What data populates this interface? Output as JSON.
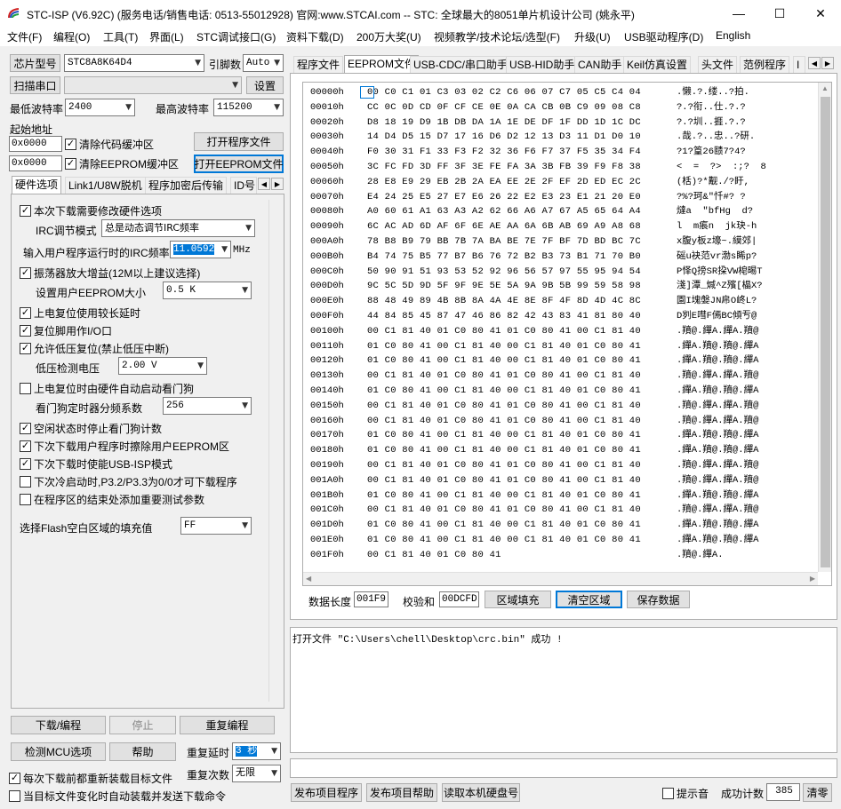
{
  "window": {
    "title": "STC-ISP (V6.92C) (服务电话/销售电话: 0513-55012928) 官网:www.STCAI.com  -- STC: 全球最大的8051单片机设计公司 (姚永平)",
    "minimize": "—",
    "maximize": "☐",
    "close": "✕"
  },
  "menu": [
    "文件(F)",
    "编程(O)",
    "工具(T)",
    "界面(L)",
    "STC调试接口(G)",
    "资料下载(D)",
    "200万大奖(U)",
    "视频教学/技术论坛/选型(F)",
    "升级(U)",
    "USB驱动程序(D)",
    "English"
  ],
  "left": {
    "chip_label": "芯片型号",
    "chip_value": "STC8A8K64D4",
    "pin_label": "引脚数",
    "pin_value": "Auto",
    "scan_label": "扫描串口",
    "port_value": "",
    "settings_label": "设置",
    "min_baud_label": "最低波特率",
    "min_baud_value": "2400",
    "max_baud_label": "最高波特率",
    "max_baud_value": "115200",
    "start_addr_label": "起始地址",
    "addr1_value": "0x0000",
    "clear_code_label": "清除代码缓冲区",
    "open_prog_label": "打开程序文件",
    "addr2_value": "0x0000",
    "clear_eeprom_label": "清除EEPROM缓冲区",
    "open_eeprom_label": "打开EEPROM文件",
    "tabs": [
      "硬件选项",
      "Link1/U8W脱机",
      "程序加密后传输",
      "ID号"
    ],
    "options": {
      "opt1": "本次下载需要修改硬件选项",
      "irc_mode_label": "IRC调节模式",
      "irc_mode_value": "总是动态调节IRC频率",
      "irc_freq_label": "输入用户程序运行时的IRC频率",
      "irc_freq_value": "11.0592",
      "irc_unit": "MHz",
      "opt2": "振荡器放大增益(12M以上建议选择)",
      "eeprom_size_label": "设置用户EEPROM大小",
      "eeprom_size_value": "0.5 K",
      "opt3": "上电复位使用较长延时",
      "opt4": "复位脚用作I/O口",
      "opt5": "允许低压复位(禁止低压中断)",
      "low_volt_label": "低压检测电压",
      "low_volt_value": "2.00 V",
      "opt6": "上电复位时由硬件自动启动看门狗",
      "wdt_label": "看门狗定时器分频系数",
      "wdt_value": "256",
      "opt7": "空闲状态时停止看门狗计数",
      "opt8": "下次下载用户程序时擦除用户EEPROM区",
      "opt9": "下次下载时使能USB-ISP模式",
      "opt10": "下次冷启动时,P3.2/P3.3为0/0才可下载程序",
      "opt11": "在程序区的结束处添加重要测试参数",
      "fill_label": "选择Flash空白区域的填充值",
      "fill_value": "FF"
    },
    "download_label": "下载/编程",
    "stop_label": "停止",
    "reprog_label": "重复编程",
    "detect_label": "检测MCU选项",
    "help_label": "帮助",
    "repeat_delay_label": "重复延时",
    "repeat_delay_value": "3 秒",
    "repeat_count_label": "重复次数",
    "repeat_count_value": "无限",
    "reload_label": "每次下载前都重新装载目标文件",
    "auto_label": "当目标文件变化时自动装载并发送下载命令"
  },
  "right": {
    "tabs": [
      "程序文件",
      "EEPROM文件",
      "USB-CDC/串口助手",
      "USB-HID助手",
      "CAN助手",
      "Keil仿真设置",
      "头文件",
      "范例程序",
      "I"
    ],
    "hex_rows": [
      {
        "addr": "00000h",
        "bytes": "00 C0 C1 01 C3 03 02 C2 C6 06 07 C7 05 C5 C4 04",
        "ascii": ".懒.?.缕..?拍."
      },
      {
        "addr": "00010h",
        "bytes": "CC 0C 0D CD 0F CF CE 0E 0A CA CB 0B C9 09 08 C8",
        "ascii": "?.?衔..仕.?.?"
      },
      {
        "addr": "00020h",
        "bytes": "D8 18 19 D9 1B DB DA 1A 1E DE DF 1F DD 1D 1C DC",
        "ascii": "?.?圳..捱.?.?"
      },
      {
        "addr": "00030h",
        "bytes": "14 D4 D5 15 D7 17 16 D6 D2 12 13 D3 11 D1 D0 10",
        "ascii": ".哉.?..忠..?研."
      },
      {
        "addr": "00040h",
        "bytes": "F0 30 31 F1 33 F3 F2 32 36 F6 F7 37 F5 35 34 F4",
        "ascii": "?1?篁26赜7?4?"
      },
      {
        "addr": "00050h",
        "bytes": "3C FC FD 3D FF 3F 3E FE FA 3A 3B FB 39 F9 F8 38",
        "ascii": "<  =  ?>  :;?  8"
      },
      {
        "addr": "00060h",
        "bytes": "28 E8 E9 29 EB 2B 2A EA EE 2E 2F EF 2D ED EC 2C",
        "ascii": "(栝)?*觏./?盱,"
      },
      {
        "addr": "00070h",
        "bytes": "E4 24 25 E5 27 E7 E6 26 22 E2 E3 23 E1 21 20 E0",
        "ascii": "?%?珂&\"忏#? ?"
      },
      {
        "addr": "00080h",
        "bytes": "A0 60 61 A1 63 A3 A2 62 66 A6 A7 67 A5 65 64 A4",
        "ascii": "燵a  \"bfHg  d?"
      },
      {
        "addr": "00090h",
        "bytes": "6C AC AD 6D AF 6F 6E AE AA 6A 6B AB 69 A9 A8 68",
        "ascii": "l  m痮n  jk玦-h"
      },
      {
        "addr": "000A0h",
        "bytes": "78 B8 B9 79 BB 7B 7A BA BE 7E 7F BF 7D BD BC 7C",
        "ascii": "x腹y板z壕~.縸郊|"
      },
      {
        "addr": "000B0h",
        "bytes": "B4 74 75 B5 77 B7 B6 76 72 B2 B3 73 B1 71 70 B0",
        "ascii": "磘u袂范vr渤s睎p?"
      },
      {
        "addr": "000C0h",
        "bytes": "50 90 91 51 93 53 52 92 96 56 57 97 55 95 94 54",
        "ascii": "P怿Q搒SR挅VW梍晹T"
      },
      {
        "addr": "000D0h",
        "bytes": "9C 5C 5D 9D 5F 9F 9E 5E 5A 9A 9B 5B 99 59 58 98",
        "ascii": "淺]潭_煘^Z殯[橸X?"
      },
      {
        "addr": "000E0h",
        "bytes": "88 48 49 89 4B 8B 8A 4A 4E 8E 8F 4F 8D 4D 4C 8C",
        "ascii": "園I塊媻JN帍O峂L?"
      },
      {
        "addr": "000F0h",
        "bytes": "44 84 85 45 87 47 46 86 82 42 43 83 41 81 80 40",
        "ascii": "D刿E嘒F傿BC傾亐@"
      },
      {
        "addr": "00100h",
        "bytes": "00 C1 81 40 01 C0 80 41 01 C0 80 41 00 C1 81 40",
        "ascii": ".羵@.繟A.繟A.羵@"
      },
      {
        "addr": "00110h",
        "bytes": "01 C0 80 41 00 C1 81 40 00 C1 81 40 01 C0 80 41",
        "ascii": ".繟A.羵@.羵@.繟A"
      },
      {
        "addr": "00120h",
        "bytes": "01 C0 80 41 00 C1 81 40 00 C1 81 40 01 C0 80 41",
        "ascii": ".繟A.羵@.羵@.繟A"
      },
      {
        "addr": "00130h",
        "bytes": "00 C1 81 40 01 C0 80 41 01 C0 80 41 00 C1 81 40",
        "ascii": ".羵@.繟A.繟A.羵@"
      },
      {
        "addr": "00140h",
        "bytes": "01 C0 80 41 00 C1 81 40 00 C1 81 40 01 C0 80 41",
        "ascii": ".繟A.羵@.羵@.繟A"
      },
      {
        "addr": "00150h",
        "bytes": "00 C1 81 40 01 C0 80 41 01 C0 80 41 00 C1 81 40",
        "ascii": ".羵@.繟A.繟A.羵@"
      },
      {
        "addr": "00160h",
        "bytes": "00 C1 81 40 01 C0 80 41 01 C0 80 41 00 C1 81 40",
        "ascii": ".羵@.繟A.繟A.羵@"
      },
      {
        "addr": "00170h",
        "bytes": "01 C0 80 41 00 C1 81 40 00 C1 81 40 01 C0 80 41",
        "ascii": ".繟A.羵@.羵@.繟A"
      },
      {
        "addr": "00180h",
        "bytes": "01 C0 80 41 00 C1 81 40 00 C1 81 40 01 C0 80 41",
        "ascii": ".繟A.羵@.羵@.繟A"
      },
      {
        "addr": "00190h",
        "bytes": "00 C1 81 40 01 C0 80 41 01 C0 80 41 00 C1 81 40",
        "ascii": ".羵@.繟A.繟A.羵@"
      },
      {
        "addr": "001A0h",
        "bytes": "00 C1 81 40 01 C0 80 41 01 C0 80 41 00 C1 81 40",
        "ascii": ".羵@.繟A.繟A.羵@"
      },
      {
        "addr": "001B0h",
        "bytes": "01 C0 80 41 00 C1 81 40 00 C1 81 40 01 C0 80 41",
        "ascii": ".繟A.羵@.羵@.繟A"
      },
      {
        "addr": "001C0h",
        "bytes": "00 C1 81 40 01 C0 80 41 01 C0 80 41 00 C1 81 40",
        "ascii": ".羵@.繟A.繟A.羵@"
      },
      {
        "addr": "001D0h",
        "bytes": "01 C0 80 41 00 C1 81 40 00 C1 81 40 01 C0 80 41",
        "ascii": ".繟A.羵@.羵@.繟A"
      },
      {
        "addr": "001E0h",
        "bytes": "01 C0 80 41 00 C1 81 40 00 C1 81 40 01 C0 80 41",
        "ascii": ".繟A.羵@.羵@.繟A"
      },
      {
        "addr": "001F0h",
        "bytes": "00 C1 81 40 01 C0 80 41",
        "ascii": ".羵@.繟A."
      }
    ],
    "length_label": "数据长度",
    "length_value": "001F9",
    "checksum_label": "校验和",
    "checksum_value": "00DCFD",
    "fill_btn": "区域填充",
    "clear_btn": "清空区域",
    "save_btn": "保存数据",
    "log_text": "打开文件 \"C:\\Users\\chell\\Desktop\\crc.bin\" 成功 !",
    "publish_prog": "发布项目程序",
    "publish_help": "发布项目帮助",
    "read_disk": "读取本机硬盘号",
    "beep_label": "提示音",
    "success_label": "成功计数",
    "success_value": "385",
    "clear_label": "清零"
  }
}
